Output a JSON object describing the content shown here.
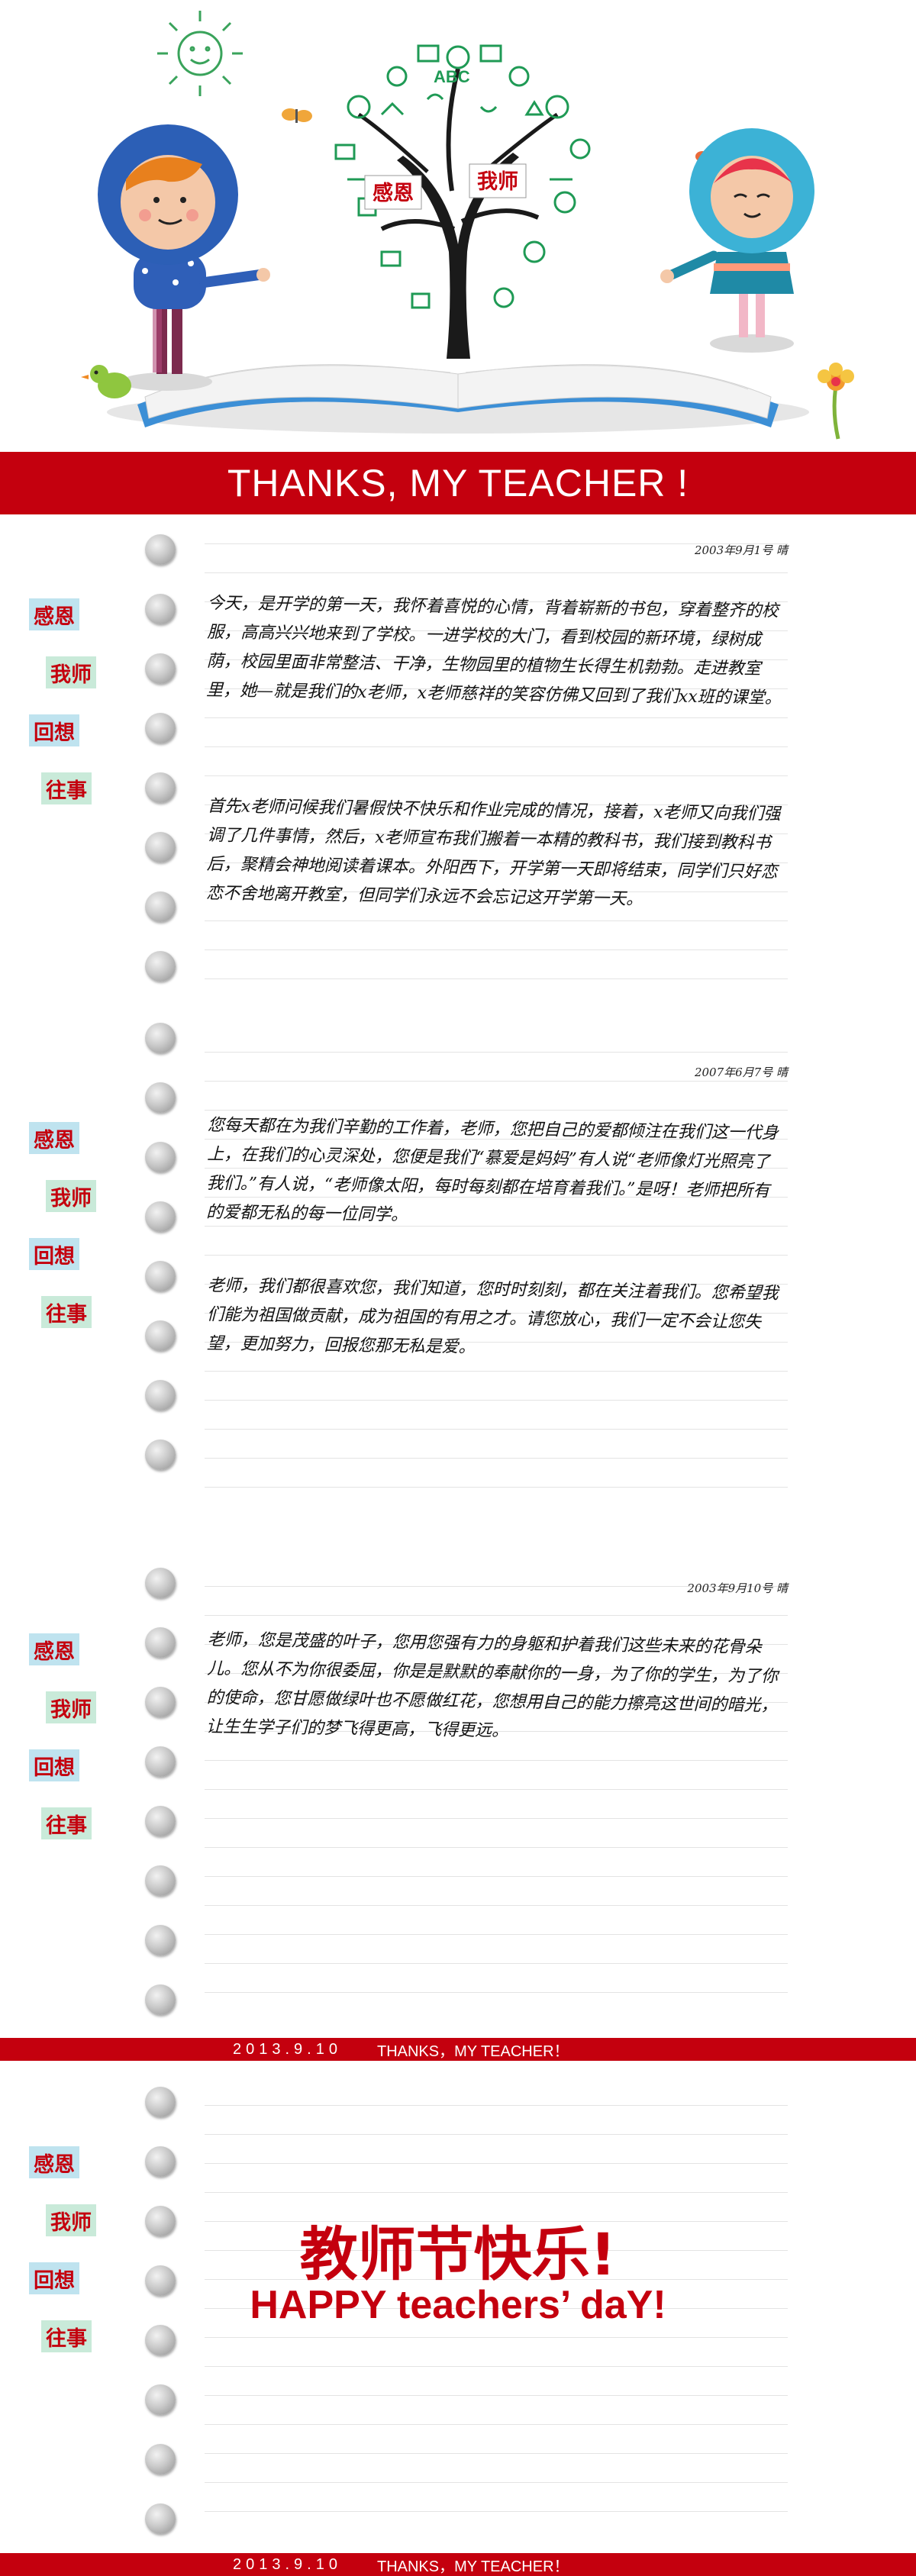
{
  "hero": {
    "tree_labels": [
      "感恩",
      "我师"
    ]
  },
  "banner": {
    "title": "THANKS, MY TEACHER !"
  },
  "stamps": [
    "感恩",
    "我师",
    "回想",
    "往事"
  ],
  "entries": [
    {
      "date": "2003年9月1号  晴",
      "paragraphs": [
        "今天，是开学的第一天，我怀着喜悦的心情，背着崭新的书包，穿着整齐的校服，高高兴兴地来到了学校。一进学校的大门，看到校园的新环境，绿树成荫，校园里面非常整洁、干净，生物园里的植物生长得生机勃勃。走进教室里，她—就是我们的x老师，x老师慈祥的笑容仿佛又回到了我们xx班的课堂。",
        "首先x老师问候我们暑假快不快乐和作业完成的情况，接着，x老师又向我们强调了几件事情，然后，x老师宣布我们搬着一本精的教科书，我们接到教科书后，聚精会神地阅读着课本。外阳西下，开学第一天即将结束，同学们只好恋恋不舍地离开教室，但同学们永远不会忘记这开学第一天。"
      ]
    },
    {
      "date": "2007年6月7号  晴",
      "paragraphs": [
        "您每天都在为我们辛勤的工作着，老师，您把自己的爱都倾注在我们这一代身上，在我们的心灵深处，您便是我们“慕爱是妈妈”有人说“老师像灯光照亮了我们。”有人说，“老师像太阳，每时每刻都在培育着我们。”是呀！老师把所有的爱都无私的每一位同学。",
        "老师，我们都很喜欢您，我们知道，您时时刻刻，都在关注着我们。您希望我们能为祖国做贡献，成为祖国的有用之才。请您放心，我们一定不会让您失望，更加努力，回报您那无私是爱。"
      ]
    },
    {
      "date": "2003年9月10号  晴",
      "paragraphs": [
        "老师，您是茂盛的叶子，您用您强有力的身躯和护着我们这些未来的花骨朵儿。您从不为你很委屈，你是是默默的奉献你的一身，为了你的学生，为了你的使命，您甘愿做绿叶也不愿做红花，您想用自己的能力擦亮这世间的暗光，让生生学子们的梦飞得更高，飞得更远。"
      ]
    }
  ],
  "strip": {
    "date": "2013.9.10",
    "text": "THANKS，MY TEACHER！"
  },
  "finale": {
    "zh": "教师节快乐!",
    "en": "HAPPY teachers’ daY!"
  },
  "colors": {
    "brand_red": "#c4000e",
    "leaf_green": "#1f9a55"
  }
}
